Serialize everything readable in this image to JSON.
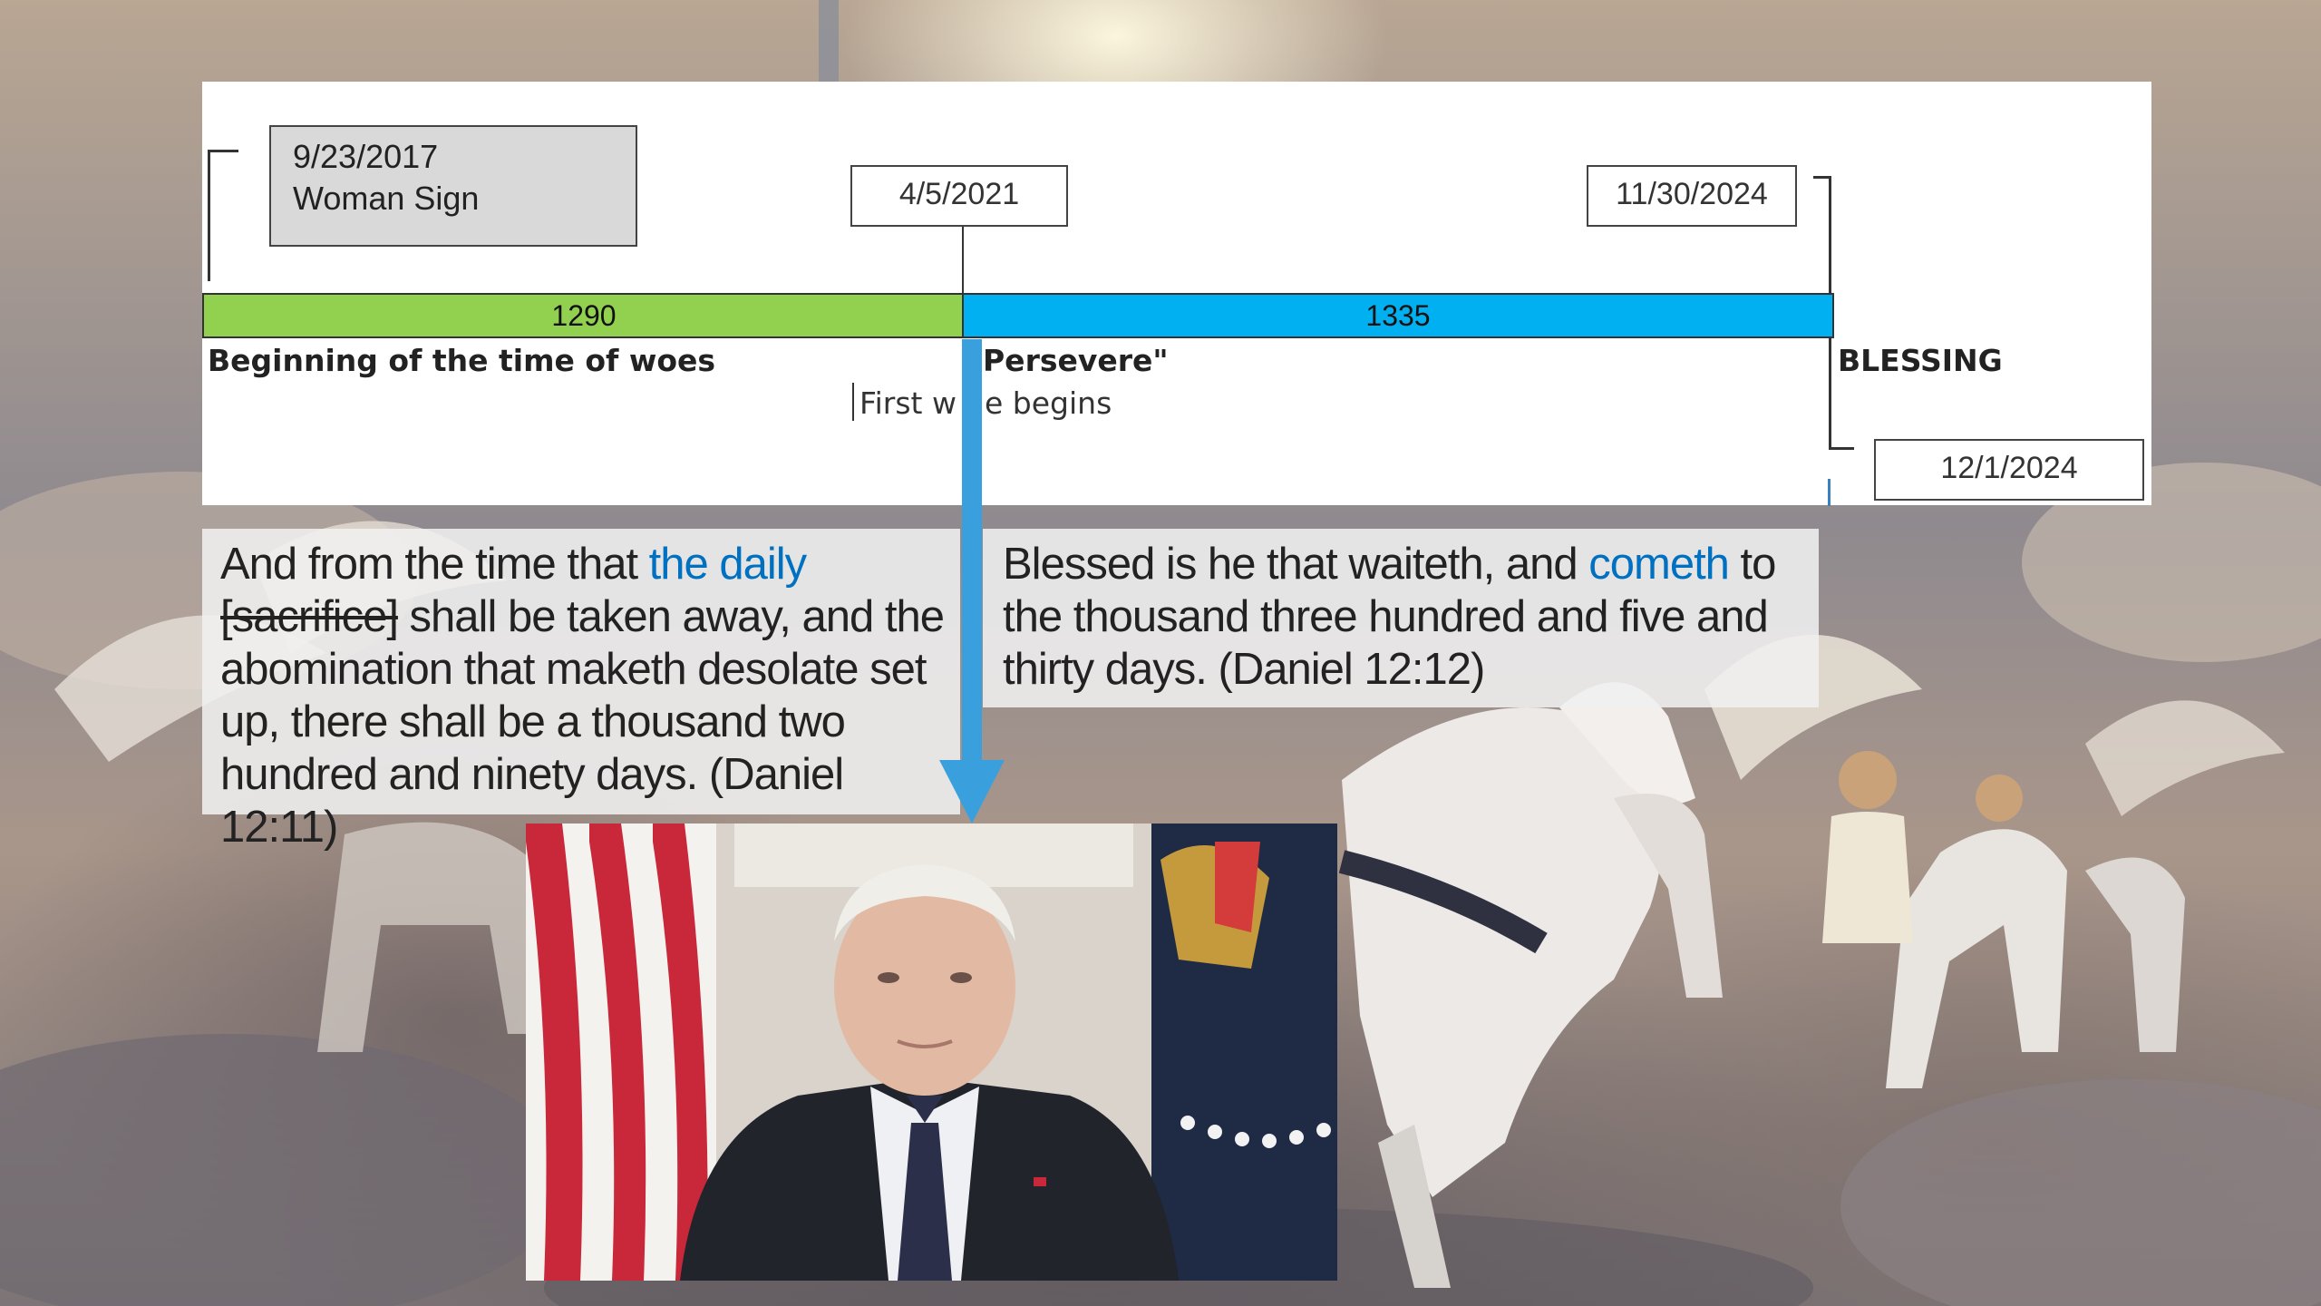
{
  "timeline": {
    "start_event": {
      "date": "9/23/2017",
      "name": "Woman Sign"
    },
    "dates": [
      "4/5/2021",
      "11/30/2024",
      "12/1/2024"
    ],
    "periods": [
      {
        "label": "1290",
        "color": "#92d050"
      },
      {
        "label": "1335",
        "color": "#00b0f0"
      }
    ],
    "labels": {
      "woes": "Beginning of the time of woes",
      "persevere": "Persevere\"",
      "first_woe_a": "First w",
      "first_woe_b": "e begins",
      "blessing": "BLESSING"
    }
  },
  "quotes": {
    "daniel_12_11": {
      "pre": "And from the time that ",
      "highlight": "the daily",
      "struck": "[sacrifice]",
      "post": " shall be taken away, and the abomination that maketh desolate set up, there shall be a thousand two hundred and ninety days. (Daniel 12:11)"
    },
    "daniel_12_12": {
      "pre": "Blessed is he that waiteth, and ",
      "highlight": "cometh",
      "post": " to the thousand three hundred and five and thirty days. (Daniel 12:12)"
    }
  },
  "colors": {
    "accent_blue": "#0070c0",
    "arrow": "#3aa0dd"
  },
  "icons": [
    "down-arrow-icon"
  ]
}
